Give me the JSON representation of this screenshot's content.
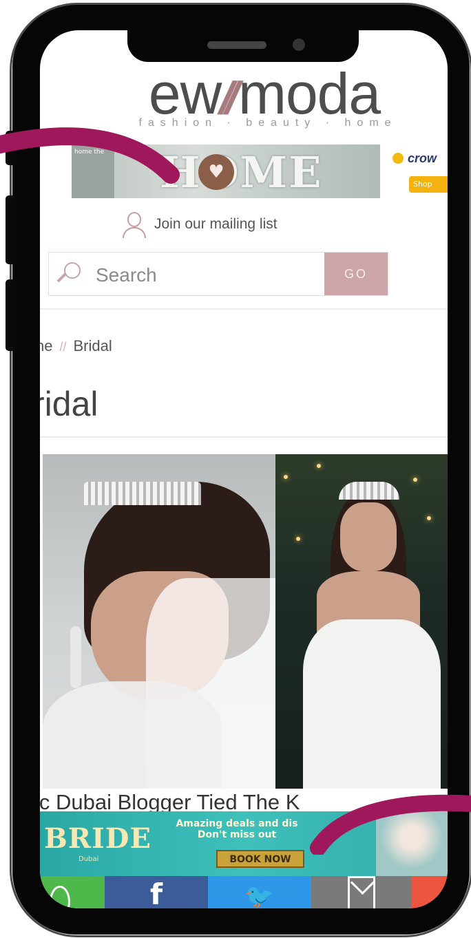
{
  "site": {
    "logo_text_left": "ew",
    "logo_slash": "//",
    "logo_text_right": "moda",
    "tagline": "fashion · beauty · home"
  },
  "ads": {
    "home_banner_text": "HOME",
    "home_banner_small_text": "home the",
    "crow_ad_brand": "crow",
    "crow_ad_button": "Shop"
  },
  "header": {
    "mailing_list_label": "Join our mailing list",
    "search_placeholder": "Search",
    "search_button": "GO"
  },
  "breadcrumb": {
    "home": "ne",
    "separator": "//",
    "current": "Bridal"
  },
  "page": {
    "title": "ridal",
    "article_headline": "ic Dubai Blogger Tied The K"
  },
  "bottom_ad": {
    "logo": "BRIDE",
    "sub": "Dubai",
    "tagline_line1": "Amazing deals and dis",
    "tagline_line2": "Don't miss out",
    "button": "BOOK NOW"
  },
  "share": {
    "facebook_glyph": "f",
    "twitter_glyph": "🐦"
  },
  "colors": {
    "accent": "#a0185c",
    "brand_rose": "#cda6a9",
    "facebook": "#3b5b99",
    "twitter": "#2e97e8",
    "whatsapp": "#4fb84a",
    "mail": "#7a7a7a",
    "more": "#ed5540"
  }
}
